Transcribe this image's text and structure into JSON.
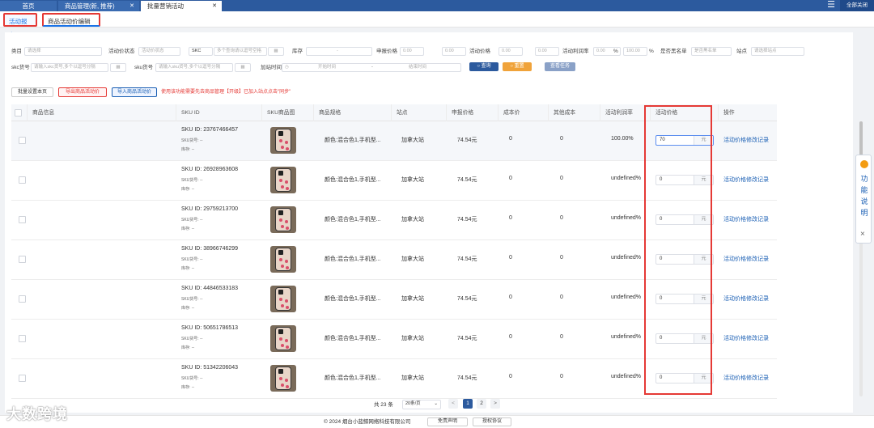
{
  "topbar": {
    "tabs": [
      {
        "label": "首页"
      },
      {
        "label": "商品管理(新, 推荐)"
      },
      {
        "label": "批量营销活动"
      }
    ],
    "close_all": "全部关闭"
  },
  "subtabs": [
    "活动报名",
    "商品活动价编辑"
  ],
  "filters": {
    "category_label": "类目",
    "category_ph": "请选择",
    "act_status_label": "活动价状态",
    "act_status_ph": "活动价状态",
    "skc_select": "SKC",
    "skc_ph": "多个查询请以逗号空格",
    "stock_label": "库存",
    "stock_dash": "-",
    "declare_label": "申报价格",
    "declare_from": "0.00",
    "declare_to": "0.00",
    "actprice_label": "活动价格",
    "actprice_from": "0.00",
    "actprice_to": "0.00",
    "rate_label": "活动利润率",
    "rate_from": "0.00",
    "rate_to": "100.00",
    "pct": "%",
    "blacklist_label": "是否黑名单",
    "blacklist_ph": "是否黑名单",
    "site_label": "站点",
    "site_ph": "请选择站点",
    "skc_no_label": "skc货号",
    "skc_no_ph": "请输入skc货号,多个以逗号分隔",
    "sku_no_label": "sku货号",
    "sku_no_ph": "请输入sku货号,多个以逗号分隔",
    "add_time_label": "加站时间",
    "start_ph": "开始时间",
    "end_ph": "结束时间",
    "query_btn": "查询",
    "reset_btn": "重置",
    "task_btn": "查看任务"
  },
  "actions": {
    "batch_cost": "批量设置本页",
    "export": "导出商品活动价",
    "import": "导入商品活动价",
    "warning": "使用该功能需要先去商品管理【开级】已加入站点点击\"同步\""
  },
  "table": {
    "headers": [
      "商品信息",
      "SKU ID",
      "SKU商品图",
      "商品规格",
      "站点",
      "申报价格",
      "成本价",
      "其他成本",
      "活动利润率",
      "活动价格",
      "操作"
    ],
    "sku_no_label": "SKU货号: --",
    "stock_label": "库存: --",
    "unit": "元",
    "op_label": "活动价格修改记录",
    "rows": [
      {
        "sku": "SKU ID: 23767466457",
        "spec": "颜色:混合色1,手机型...",
        "site": "加拿大站",
        "declare": "74.54元",
        "cost": "0",
        "other": "0",
        "rate": "100.00%",
        "price": "70"
      },
      {
        "sku": "SKU ID: 26928963608",
        "spec": "颜色:混合色1,手机型...",
        "site": "加拿大站",
        "declare": "74.54元",
        "cost": "0",
        "other": "0",
        "rate": "undefined%",
        "price": "0"
      },
      {
        "sku": "SKU ID: 29759213700",
        "spec": "颜色:混合色1,手机型...",
        "site": "加拿大站",
        "declare": "74.54元",
        "cost": "0",
        "other": "0",
        "rate": "undefined%",
        "price": "0"
      },
      {
        "sku": "SKU ID: 38966746299",
        "spec": "颜色:混合色1,手机型...",
        "site": "加拿大站",
        "declare": "74.54元",
        "cost": "0",
        "other": "0",
        "rate": "undefined%",
        "price": "0"
      },
      {
        "sku": "SKU ID: 44846533183",
        "spec": "颜色:混合色1,手机型...",
        "site": "加拿大站",
        "declare": "74.54元",
        "cost": "0",
        "other": "0",
        "rate": "undefined%",
        "price": "0"
      },
      {
        "sku": "SKU ID: 50651786513",
        "spec": "颜色:混合色1,手机型...",
        "site": "加拿大站",
        "declare": "74.54元",
        "cost": "0",
        "other": "0",
        "rate": "undefined%",
        "price": "0"
      },
      {
        "sku": "SKU ID: 51342206043",
        "spec": "颜色:混合色1,手机型...",
        "site": "加拿大站",
        "declare": "74.54元",
        "cost": "0",
        "other": "0",
        "rate": "undefined%",
        "price": "0"
      }
    ]
  },
  "pager": {
    "total": "共 23 条",
    "size": "20条/页",
    "pages": [
      "1",
      "2"
    ],
    "prev": "<",
    "next": ">"
  },
  "help": {
    "text": "功能说明",
    "close": "×"
  },
  "footer": {
    "copy": "© 2024 烟台小蓝鲸网络科技有限公司",
    "disclaimer": "免责声明",
    "license": "授权协议"
  },
  "watermark": "大数跨境",
  "colors": {
    "brand": "#2c5a9e",
    "highlight": "#e53935",
    "link": "#1a5fb4"
  }
}
